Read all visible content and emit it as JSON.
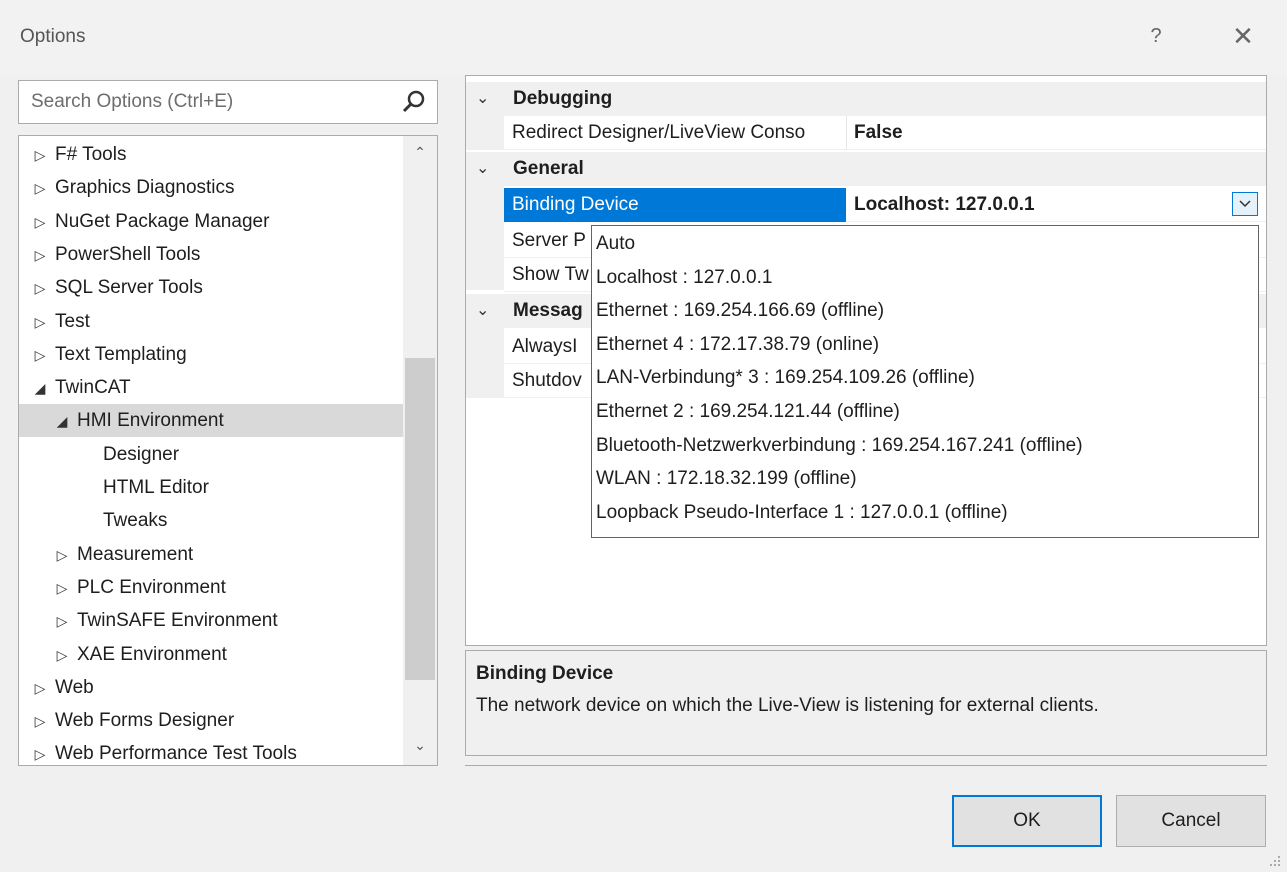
{
  "dialog": {
    "title": "Options",
    "help": "?",
    "close": "✕"
  },
  "search": {
    "placeholder": "Search Options (Ctrl+E)"
  },
  "tree": [
    {
      "arrow": "▷",
      "label": "F# Tools",
      "level": 0
    },
    {
      "arrow": "▷",
      "label": "Graphics Diagnostics",
      "level": 0
    },
    {
      "arrow": "▷",
      "label": "NuGet Package Manager",
      "level": 0
    },
    {
      "arrow": "▷",
      "label": "PowerShell Tools",
      "level": 0
    },
    {
      "arrow": "▷",
      "label": "SQL Server Tools",
      "level": 0
    },
    {
      "arrow": "▷",
      "label": "Test",
      "level": 0
    },
    {
      "arrow": "▷",
      "label": "Text Templating",
      "level": 0
    },
    {
      "arrow": "◢",
      "label": "TwinCAT",
      "level": 0
    },
    {
      "arrow": "◢",
      "label": "HMI Environment",
      "level": 1,
      "selected": true
    },
    {
      "arrow": "",
      "label": "Designer",
      "level": 2
    },
    {
      "arrow": "",
      "label": "HTML Editor",
      "level": 2
    },
    {
      "arrow": "",
      "label": "Tweaks",
      "level": 2
    },
    {
      "arrow": "▷",
      "label": "Measurement",
      "level": 1
    },
    {
      "arrow": "▷",
      "label": "PLC Environment",
      "level": 1
    },
    {
      "arrow": "▷",
      "label": "TwinSAFE Environment",
      "level": 1
    },
    {
      "arrow": "▷",
      "label": "XAE Environment",
      "level": 1
    },
    {
      "arrow": "▷",
      "label": "Web",
      "level": 0
    },
    {
      "arrow": "▷",
      "label": "Web Forms Designer",
      "level": 0
    },
    {
      "arrow": "▷",
      "label": "Web Performance Test Tools",
      "level": 0
    }
  ],
  "scroll": {
    "up": "⌃",
    "down": "⌄"
  },
  "grid": {
    "categories": [
      {
        "label": "Debugging",
        "chev": "⌄"
      },
      {
        "label": "General",
        "chev": "⌄"
      },
      {
        "label": "Messag",
        "chev": "⌄"
      }
    ],
    "properties": {
      "redirect": {
        "name": "Redirect Designer/LiveView Conso",
        "value": "False"
      },
      "binding": {
        "name": "Binding Device",
        "value": "Localhost: 127.0.0.1"
      },
      "server": {
        "name": "Server P",
        "value": ""
      },
      "show": {
        "name": "Show Tw",
        "value": ""
      },
      "always": {
        "name": "AlwaysI",
        "value": ""
      },
      "shutdown": {
        "name": "Shutdov",
        "value": ""
      }
    }
  },
  "dropdown": [
    "Auto",
    "Localhost : 127.0.0.1",
    "Ethernet : 169.254.166.69 (offline)",
    "Ethernet 4 : 172.17.38.79 (online)",
    "LAN-Verbindung* 3 : 169.254.109.26 (offline)",
    "Ethernet 2 : 169.254.121.44 (offline)",
    "Bluetooth-Netzwerkverbindung : 169.254.167.241 (offline)",
    "WLAN : 172.18.32.199 (offline)",
    "Loopback Pseudo-Interface 1 : 127.0.0.1 (offline)"
  ],
  "description": {
    "title": "Binding Device",
    "text": "The network device on which the Live-View is listening for external clients."
  },
  "buttons": {
    "ok": "OK",
    "cancel": "Cancel"
  },
  "colors": {
    "selection": "#0078d7",
    "tree_selection": "#d9d9d9"
  }
}
